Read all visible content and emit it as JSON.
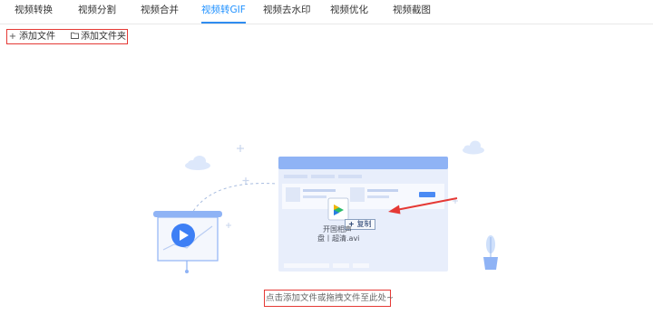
{
  "tabs": [
    {
      "label": "视频转换"
    },
    {
      "label": "视频分割"
    },
    {
      "label": "视频合并"
    },
    {
      "label": "视频转GIF",
      "active": true
    },
    {
      "label": "视频去水印"
    },
    {
      "label": "视频优化"
    },
    {
      "label": "视频截图"
    }
  ],
  "toolbar": {
    "add_file_label": "添加文件",
    "add_folder_label": "添加文件夹",
    "add_file_icon": "plus-icon",
    "add_folder_icon": "folder-icon"
  },
  "drop_zone": {
    "hint": "点击添加文件或拖拽文件至此处~",
    "dragged_file_line1": "开国相声",
    "dragged_file_line2": "盘丨超清.avi",
    "copy_badge": "复制"
  },
  "colors": {
    "accent": "#2f8cf0",
    "highlight_border": "#e53935",
    "illustration_blue": "#8fb3f5",
    "illustration_light": "#eef3ff"
  }
}
